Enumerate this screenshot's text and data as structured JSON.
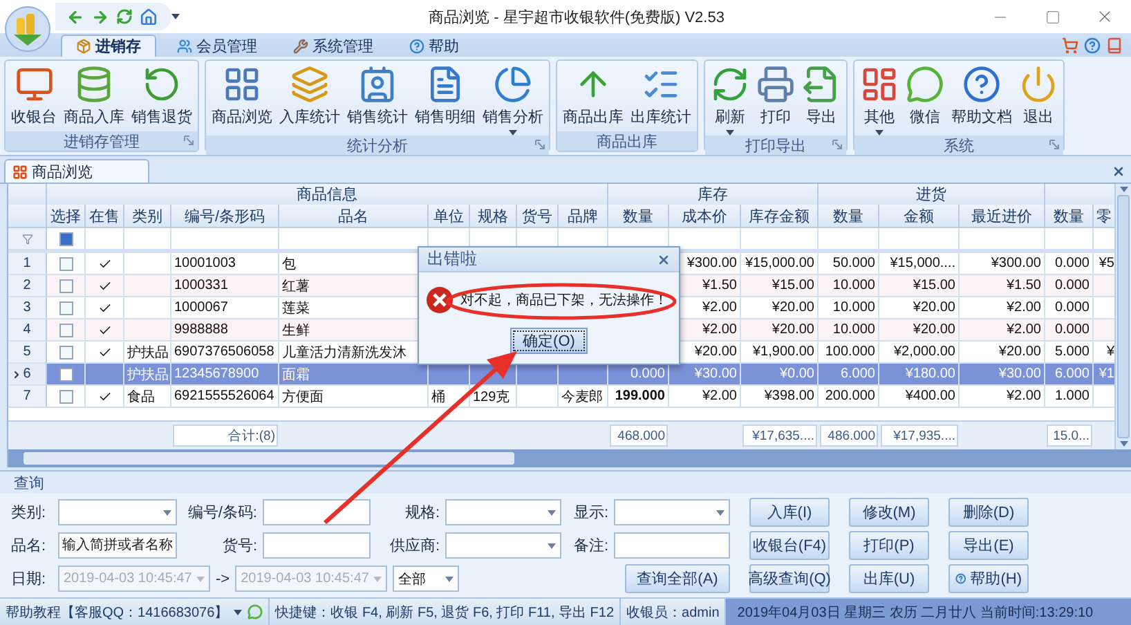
{
  "window": {
    "title": "商品浏览 - 星宇超市收银软件(免费版) V2.53"
  },
  "ribbon": {
    "tabs": [
      {
        "label": "进销存",
        "selected": true
      },
      {
        "label": "会员管理",
        "selected": false
      },
      {
        "label": "系统管理",
        "selected": false
      },
      {
        "label": "帮助",
        "selected": false
      }
    ],
    "groups": [
      {
        "label": "进销存管理",
        "launcher": true,
        "buttons": [
          {
            "label": "收银台",
            "dropdown": false
          },
          {
            "label": "商品入库",
            "dropdown": false
          },
          {
            "label": "销售退货",
            "dropdown": false
          }
        ]
      },
      {
        "label": "统计分析",
        "launcher": true,
        "buttons": [
          {
            "label": "商品浏览",
            "dropdown": false
          },
          {
            "label": "入库统计",
            "dropdown": false
          },
          {
            "label": "销售统计",
            "dropdown": false
          },
          {
            "label": "销售明细",
            "dropdown": false
          },
          {
            "label": "销售分析",
            "dropdown": true
          }
        ]
      },
      {
        "label": "商品出库",
        "launcher": false,
        "buttons": [
          {
            "label": "商品出库",
            "dropdown": false
          },
          {
            "label": "出库统计",
            "dropdown": false
          }
        ]
      },
      {
        "label": "打印导出",
        "launcher": true,
        "buttons": [
          {
            "label": "刷新",
            "dropdown": true
          },
          {
            "label": "打印",
            "dropdown": false
          },
          {
            "label": "导出",
            "dropdown": false
          }
        ]
      },
      {
        "label": "系统",
        "launcher": true,
        "buttons": [
          {
            "label": "其他",
            "dropdown": true
          },
          {
            "label": "微信",
            "dropdown": false
          },
          {
            "label": "帮助文档",
            "dropdown": false
          },
          {
            "label": "退出",
            "dropdown": false
          }
        ]
      }
    ]
  },
  "document_tabs": [
    {
      "label": "商品浏览",
      "selected": true
    }
  ],
  "grid": {
    "column_groups": [
      {
        "label": "商品信息",
        "columns": [
          {
            "label": "选择"
          },
          {
            "label": "在售"
          },
          {
            "label": "类别"
          },
          {
            "label": "编号/条形码",
            "total": "合计:(8)"
          },
          {
            "label": "品名"
          },
          {
            "label": "单位"
          },
          {
            "label": "规格"
          },
          {
            "label": "货号"
          },
          {
            "label": "品牌"
          }
        ]
      },
      {
        "label": "库存",
        "columns": [
          {
            "label": "数量",
            "total": "468.000"
          },
          {
            "label": "成本价"
          },
          {
            "label": "库存金额",
            "total": "¥17,635...."
          }
        ]
      },
      {
        "label": "进货",
        "columns": [
          {
            "label": "数量",
            "total": "486.000"
          },
          {
            "label": "金额",
            "total": "¥17,935...."
          },
          {
            "label": "最近进价"
          }
        ]
      },
      {
        "columns": [
          {
            "label": "数量",
            "total": "15.0..."
          },
          {
            "label": "零"
          }
        ]
      }
    ],
    "filter": {
      "checked": true
    },
    "rows": [
      {
        "number": "1",
        "selected": false,
        "checked": false,
        "on_sale": true,
        "cells": [
          null,
          "10001003",
          "包",
          null,
          null,
          null,
          null,
          null,
          "¥300.00",
          "¥15,000.00",
          "50.000",
          "¥15,000....",
          "¥300.00",
          "0.000",
          "¥5"
        ]
      },
      {
        "number": "2",
        "selected": false,
        "checked": false,
        "on_sale": true,
        "cells": [
          null,
          "1000331",
          "红薯",
          null,
          null,
          null,
          null,
          null,
          "¥1.50",
          "¥15.00",
          "10.000",
          "¥15.00",
          "¥1.50",
          "0.000",
          null
        ]
      },
      {
        "number": "3",
        "selected": false,
        "checked": false,
        "on_sale": true,
        "cells": [
          null,
          "1000067",
          "莲菜",
          null,
          null,
          null,
          null,
          null,
          "¥2.00",
          "¥20.00",
          "10.000",
          "¥20.00",
          "¥2.00",
          "0.000",
          null
        ]
      },
      {
        "number": "4",
        "selected": false,
        "checked": false,
        "on_sale": true,
        "cells": [
          null,
          "9988888",
          "生鲜",
          null,
          null,
          null,
          null,
          null,
          "¥2.00",
          "¥20.00",
          "10.000",
          "¥20.00",
          "¥2.00",
          "0.000",
          null
        ]
      },
      {
        "number": "5",
        "selected": false,
        "checked": false,
        "on_sale": true,
        "cells": [
          "护扶品",
          "6907376506058",
          "儿童活力清新洗发沐",
          null,
          null,
          null,
          null,
          null,
          "¥20.00",
          "¥1,900.00",
          "100.000",
          "¥2,000.00",
          "¥20.00",
          "5.000",
          "¥"
        ]
      },
      {
        "number": "6",
        "selected": true,
        "checked": false,
        "on_sale": false,
        "quantity_bold": false,
        "cells": [
          "护扶品",
          "12345678900",
          "面霜",
          null,
          null,
          null,
          null,
          "0.000",
          "¥30.00",
          "¥0.00",
          "6.000",
          "¥180.00",
          "¥30.00",
          "6.000",
          "¥1"
        ]
      },
      {
        "number": "7",
        "selected": false,
        "checked": false,
        "on_sale": true,
        "quantity_bold": true,
        "cells": [
          "食品",
          "6921555526064",
          "方便面",
          "桶",
          "129克",
          null,
          "今麦郎",
          "199.000",
          "¥2.00",
          "¥398.00",
          "200.000",
          "¥400.00",
          "¥2.00",
          "1.000",
          null
        ]
      }
    ]
  },
  "dialog": {
    "title": "出错啦",
    "message": "对不起，商品已下架，无法操作！",
    "button": "确定(O)"
  },
  "query": {
    "title": "查询",
    "fields": [
      {
        "label": "类别:",
        "kind": "select"
      },
      {
        "label": "编号/条码:",
        "kind": "input"
      },
      {
        "label": "规格:",
        "kind": "select"
      },
      {
        "label": "显示:",
        "kind": "select"
      },
      {
        "label": "品名:",
        "kind": "input",
        "placeholder": "输入简拼或者名称"
      },
      {
        "label": "货号:",
        "kind": "input"
      },
      {
        "label": "供应商:",
        "kind": "select"
      },
      {
        "label": "备注:",
        "kind": "input"
      }
    ],
    "date": {
      "label": "日期:",
      "from": "2019-04-03 10:45:47",
      "separator": "->",
      "to": "2019-04-03 10:45:47",
      "disabled": true,
      "period": "全部"
    },
    "search_all": "查询全部(A)",
    "buttons": [
      {
        "label": "入库(I)",
        "kind": "plain"
      },
      {
        "label": "修改(M)",
        "kind": "plain"
      },
      {
        "label": "删除(D)",
        "kind": "plain"
      },
      {
        "label": "收银台(F4)",
        "kind": "plain"
      },
      {
        "label": "打印(P)",
        "kind": "plain"
      },
      {
        "label": "导出(E)",
        "kind": "plain"
      },
      {
        "label": "高级查询(Q)",
        "kind": "plain"
      },
      {
        "label": "出库(U)",
        "kind": "plain"
      },
      {
        "label": "帮助(H)",
        "kind": "help"
      }
    ]
  },
  "status_bar": {
    "help": "帮助教程【客服QQ：1416683076】",
    "shortcuts": "快捷键：收银 F4, 刷新 F5, 退货 F6, 打印 F11, 导出 F12",
    "cashier": "收银员：admin",
    "datetime": "2019年04月03日 星期三 农历 二月廿八 当前时间:13:29:10"
  }
}
